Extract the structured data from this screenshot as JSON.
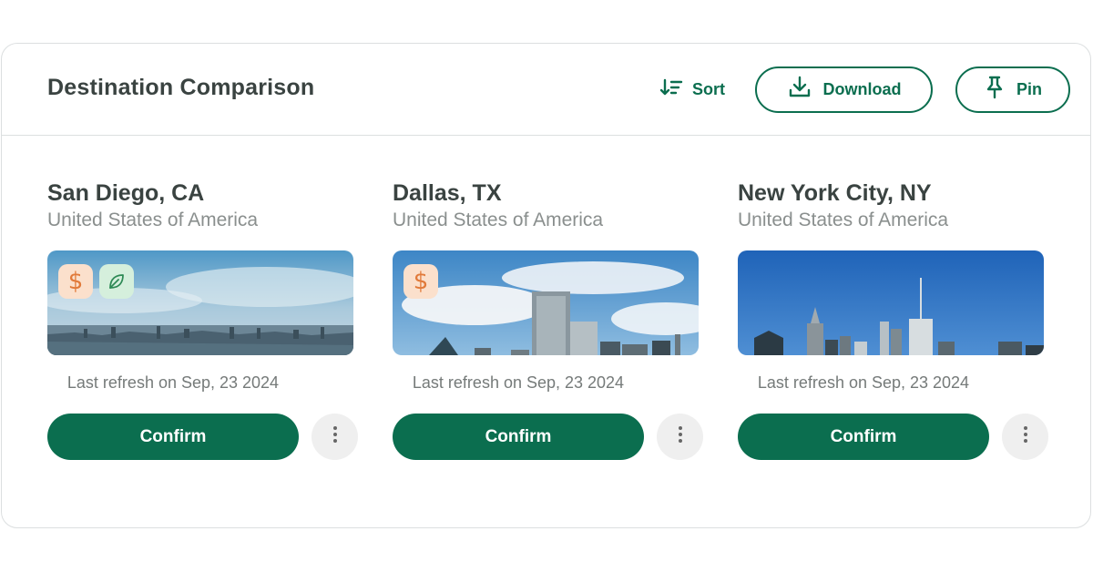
{
  "header": {
    "title": "Destination Comparison",
    "sort_label": "Sort",
    "download_label": "Download",
    "pin_label": "Pin"
  },
  "colors": {
    "brand_green": "#0b6e4f",
    "dollar_badge_bg": "#fbe0cc",
    "dollar_badge_fg": "#e17a3a",
    "leaf_badge_bg": "#d5efdc",
    "leaf_badge_fg": "#2e8a55"
  },
  "cards": [
    {
      "city": "San Diego, CA",
      "country": "United States of America",
      "badges": [
        "dollar-icon",
        "leaf-icon"
      ],
      "badge_dollar_glyph": "$",
      "refresh": "Last refresh on Sep, 23 2024",
      "confirm_label": "Confirm"
    },
    {
      "city": "Dallas, TX",
      "country": "United States of America",
      "badges": [
        "dollar-icon"
      ],
      "badge_dollar_glyph": "$",
      "refresh": "Last refresh on Sep, 23 2024",
      "confirm_label": "Confirm"
    },
    {
      "city": "New York City, NY",
      "country": "United States of America",
      "badges": [],
      "refresh": "Last refresh on Sep, 23 2024",
      "confirm_label": "Confirm"
    }
  ]
}
